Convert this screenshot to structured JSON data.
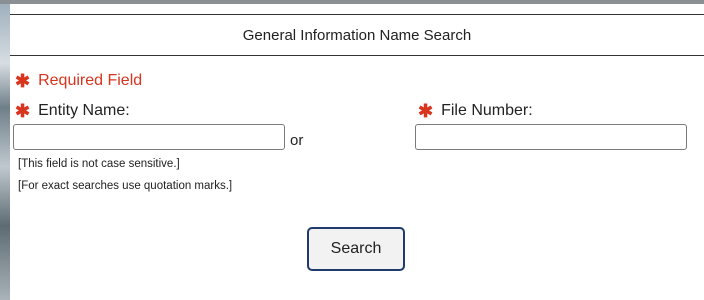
{
  "header": {
    "title": "General Information Name Search"
  },
  "required_note": {
    "text": "Required Field",
    "icon": "asterisk-icon",
    "color": "#d8341e"
  },
  "entity": {
    "label": "Entity Name:",
    "value": "",
    "placeholder": "",
    "hints": [
      "[This field is not case sensitive.]",
      "[For exact searches use quotation marks.]"
    ]
  },
  "connector": {
    "text": "or"
  },
  "file_number": {
    "label": "File Number:",
    "value": "",
    "placeholder": ""
  },
  "search_button": {
    "label": "Search",
    "border_color": "#1f3a6b"
  }
}
